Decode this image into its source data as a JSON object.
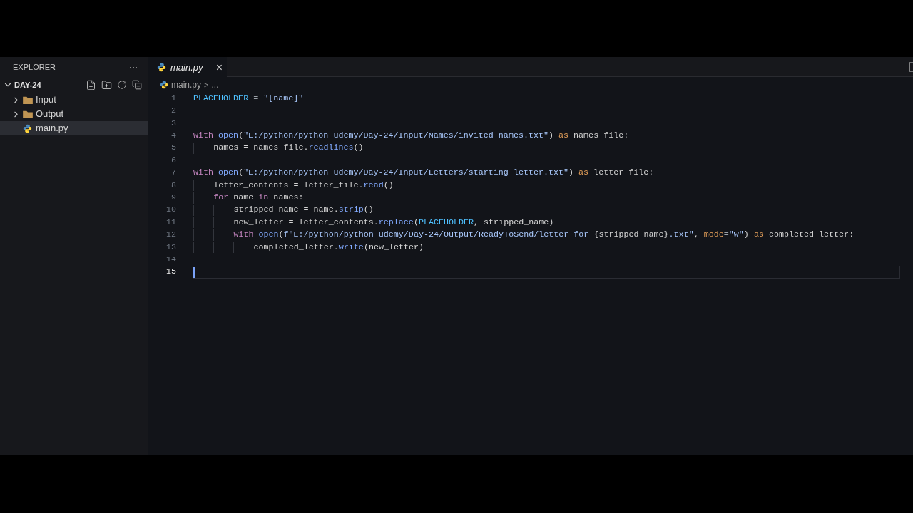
{
  "sidebar": {
    "title": "EXPLORER",
    "more": "···",
    "folder": {
      "name": "DAY-24",
      "expanded": true
    },
    "items": [
      {
        "kind": "folder",
        "name": "Input",
        "expanded": false,
        "selected": false
      },
      {
        "kind": "folder",
        "name": "Output",
        "expanded": false,
        "selected": false
      },
      {
        "kind": "python",
        "name": "main.py",
        "selected": true
      }
    ]
  },
  "tabs": [
    {
      "label": "main.py",
      "selected": true,
      "close": "×"
    }
  ],
  "breadcrumb": {
    "file": "main.py",
    "separator": ">",
    "rest": "..."
  },
  "code": {
    "lines": [
      {
        "number": "1",
        "current": false,
        "tokens": [
          {
            "kind": "const",
            "text": "PLACEHOLDER"
          },
          {
            "kind": "op",
            "text": " = "
          },
          {
            "kind": "string",
            "text": "\"[name]\""
          }
        ]
      },
      {
        "number": "2",
        "current": false
      },
      {
        "number": "3",
        "current": false
      },
      {
        "number": "4",
        "current": false,
        "tokens": [
          {
            "kind": "keyword",
            "text": "with "
          },
          {
            "kind": "func",
            "text": "open"
          },
          {
            "kind": "plain",
            "text": "("
          },
          {
            "kind": "string",
            "text": "\"E:/python/python udemy/Day-24/Input/Names/invited_names.txt\""
          },
          {
            "kind": "plain",
            "text": ") "
          },
          {
            "kind": "as",
            "text": "as"
          },
          {
            "kind": "plain",
            "text": " names_file:"
          }
        ]
      },
      {
        "number": "5",
        "current": false,
        "tokens": [
          {
            "kind": "indent"
          },
          {
            "kind": "plain",
            "text": "names = names_file."
          },
          {
            "kind": "func",
            "text": "readlines"
          },
          {
            "kind": "plain",
            "text": "()"
          }
        ]
      },
      {
        "number": "6",
        "current": false
      },
      {
        "number": "7",
        "current": false,
        "tokens": [
          {
            "kind": "keyword",
            "text": "with "
          },
          {
            "kind": "func",
            "text": "open"
          },
          {
            "kind": "plain",
            "text": "("
          },
          {
            "kind": "string",
            "text": "\"E:/python/python udemy/Day-24/Input/Letters/starting_letter.txt\""
          },
          {
            "kind": "plain",
            "text": ") "
          },
          {
            "kind": "as",
            "text": "as"
          },
          {
            "kind": "plain",
            "text": " letter_file:"
          }
        ]
      },
      {
        "number": "8",
        "current": false,
        "tokens": [
          {
            "kind": "indent"
          },
          {
            "kind": "plain",
            "text": "letter_contents = letter_file."
          },
          {
            "kind": "func",
            "text": "read"
          },
          {
            "kind": "plain",
            "text": "()"
          }
        ]
      },
      {
        "number": "9",
        "current": false,
        "tokens": [
          {
            "kind": "indent"
          },
          {
            "kind": "keyword",
            "text": "for"
          },
          {
            "kind": "plain",
            "text": " name "
          },
          {
            "kind": "keyword",
            "text": "in"
          },
          {
            "kind": "plain",
            "text": " names:"
          }
        ]
      },
      {
        "number": "10",
        "current": false,
        "tokens": [
          {
            "kind": "indent"
          },
          {
            "kind": "indent"
          },
          {
            "kind": "plain",
            "text": "stripped_name = name."
          },
          {
            "kind": "func",
            "text": "strip"
          },
          {
            "kind": "plain",
            "text": "()"
          }
        ]
      },
      {
        "number": "11",
        "current": false,
        "tokens": [
          {
            "kind": "indent"
          },
          {
            "kind": "indent"
          },
          {
            "kind": "plain",
            "text": "new_letter = letter_contents."
          },
          {
            "kind": "func",
            "text": "replace"
          },
          {
            "kind": "plain",
            "text": "("
          },
          {
            "kind": "const",
            "text": "PLACEHOLDER"
          },
          {
            "kind": "plain",
            "text": ", stripped_name)"
          }
        ]
      },
      {
        "number": "12",
        "current": false,
        "tokens": [
          {
            "kind": "indent"
          },
          {
            "kind": "indent"
          },
          {
            "kind": "keyword",
            "text": "with "
          },
          {
            "kind": "func",
            "text": "open"
          },
          {
            "kind": "plain",
            "text": "("
          },
          {
            "kind": "string",
            "text": "f\"E:/python/python udemy/Day-24/Output/ReadyToSend/letter_for_"
          },
          {
            "kind": "plain",
            "text": "{stripped_name}"
          },
          {
            "kind": "string",
            "text": ".txt\""
          },
          {
            "kind": "plain",
            "text": ", "
          },
          {
            "kind": "as",
            "text": "mode"
          },
          {
            "kind": "op",
            "text": "="
          },
          {
            "kind": "string",
            "text": "\"w\""
          },
          {
            "kind": "plain",
            "text": ") "
          },
          {
            "kind": "as",
            "text": "as"
          },
          {
            "kind": "plain",
            "text": " completed_letter:"
          }
        ]
      },
      {
        "number": "13",
        "current": false,
        "tokens": [
          {
            "kind": "indent"
          },
          {
            "kind": "indent"
          },
          {
            "kind": "indent"
          },
          {
            "kind": "plain",
            "text": "completed_letter."
          },
          {
            "kind": "func",
            "text": "write"
          },
          {
            "kind": "plain",
            "text": "(new_letter)"
          }
        ]
      },
      {
        "number": "14",
        "current": false
      },
      {
        "number": "15",
        "current": true
      }
    ]
  }
}
